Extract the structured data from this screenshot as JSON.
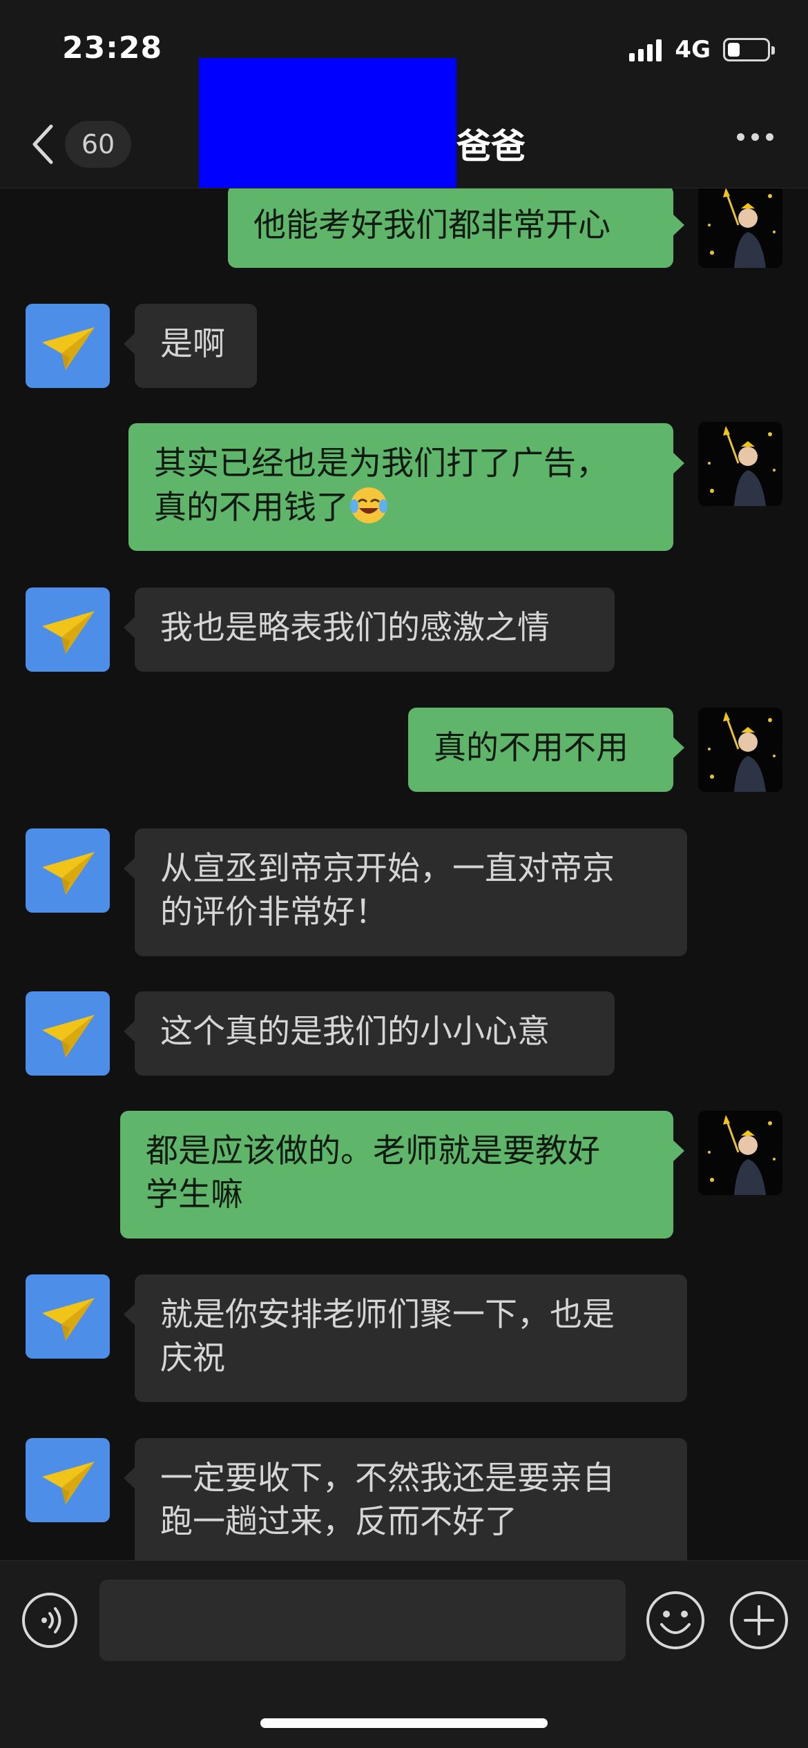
{
  "status_bar": {
    "time": "23:28",
    "network": "4G",
    "battery_level": 0.3
  },
  "nav": {
    "back_badge": "60",
    "title": "爸爸",
    "redaction_color": "#0000ff",
    "icons": {
      "back": "chevron-left-icon",
      "more": "more-dots-icon"
    }
  },
  "colors": {
    "incoming_bubble": "#2c2c2c",
    "outgoing_bubble": "#5fb56a",
    "contact_avatar": "#4d8ee8"
  },
  "messages": [
    {
      "side": "out",
      "text": "他能考好我们都非常开心"
    },
    {
      "side": "in",
      "text": "是啊"
    },
    {
      "side": "out",
      "text": "其实已经也是为我们打了广告，\n真的不用钱了",
      "emoji": "laughing-crying-emoji"
    },
    {
      "side": "in",
      "text": "我也是略表我们的感激之情"
    },
    {
      "side": "out",
      "text": "真的不用不用"
    },
    {
      "side": "in",
      "text": "从宣丞到帝京开始，一直对帝京\n的评价非常好！"
    },
    {
      "side": "in",
      "text": "这个真的是我们的小小心意"
    },
    {
      "side": "out",
      "text": "都是应该做的。老师就是要教好\n学生嘛"
    },
    {
      "side": "in",
      "text": "就是你安排老师们聚一下，也是\n庆祝"
    },
    {
      "side": "in",
      "text": "一定要收下，不然我还是要亲自\n跑一趟过来，反而不好了"
    }
  ],
  "input_bar": {
    "placeholder": "",
    "icons": [
      "voice-icon",
      "emoji-icon",
      "plus-icon"
    ]
  }
}
